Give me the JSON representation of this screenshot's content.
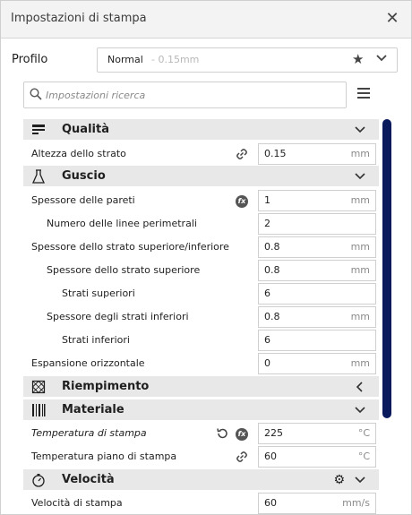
{
  "window": {
    "title": "Impostazioni di stampa",
    "close_icon": "close-icon"
  },
  "profile": {
    "label": "Profilo",
    "name": "Normal",
    "detail": "- 0.15mm"
  },
  "search": {
    "placeholder": "Impostazioni ricerca"
  },
  "categories": {
    "quality": {
      "label": "Qualità",
      "icon": "quality-icon",
      "state": "expanded"
    },
    "shell": {
      "label": "Guscio",
      "icon": "shell-icon",
      "state": "expanded"
    },
    "infill": {
      "label": "Riempimento",
      "icon": "infill-icon",
      "state": "collapsed"
    },
    "material": {
      "label": "Materiale",
      "icon": "material-icon",
      "state": "expanded"
    },
    "speed": {
      "label": "Velocità",
      "icon": "speed-icon",
      "state": "expanded"
    }
  },
  "settings": {
    "layer_height": {
      "label": "Altezza dello strato",
      "value": "0.15",
      "unit": "mm"
    },
    "wall_thickness": {
      "label": "Spessore delle pareti",
      "value": "1",
      "unit": "mm"
    },
    "wall_line_count": {
      "label": "Numero delle linee perimetrali",
      "value": "2",
      "unit": ""
    },
    "top_bottom_thickness": {
      "label": "Spessore dello strato superiore/inferiore",
      "value": "0.8",
      "unit": "mm"
    },
    "top_thickness": {
      "label": "Spessore dello strato superiore",
      "value": "0.8",
      "unit": "mm"
    },
    "top_layers": {
      "label": "Strati superiori",
      "value": "6",
      "unit": ""
    },
    "bottom_thickness": {
      "label": "Spessore degli strati inferiori",
      "value": "0.8",
      "unit": "mm"
    },
    "bottom_layers": {
      "label": "Strati inferiori",
      "value": "6",
      "unit": ""
    },
    "horizontal_expansion": {
      "label": "Espansione orizzontale",
      "value": "0",
      "unit": "mm"
    },
    "print_temperature": {
      "label": "Temperatura di stampa",
      "value": "225",
      "unit": "°C"
    },
    "bed_temperature": {
      "label": "Temperatura piano di stampa",
      "value": "60",
      "unit": "°C"
    },
    "print_speed": {
      "label": "Velocità di stampa",
      "value": "60",
      "unit": "mm/s"
    }
  },
  "colors": {
    "scrollbar": "#0b1a5c",
    "category_bg": "#e8e8e8"
  }
}
